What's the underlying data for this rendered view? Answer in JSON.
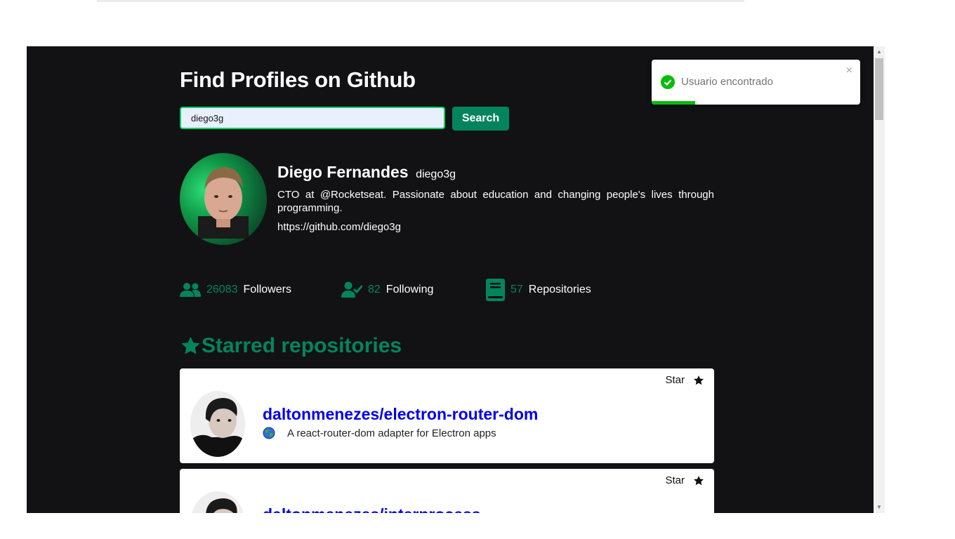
{
  "header": {
    "title": "Find Profiles on Github"
  },
  "search": {
    "value": "diego3g",
    "button_label": "Search"
  },
  "profile": {
    "name": "Diego Fernandes",
    "login": "diego3g",
    "bio": "CTO at @Rocketseat. Passionate about education and changing people's lives through programming.",
    "url": "https://github.com/diego3g"
  },
  "stats": [
    {
      "icon": "users-icon",
      "count": "26083",
      "label": "Followers"
    },
    {
      "icon": "user-check-icon",
      "count": "82",
      "label": "Following"
    },
    {
      "icon": "book-icon",
      "count": "57",
      "label": "Repositories"
    }
  ],
  "starred": {
    "title": "Starred repositories",
    "items": [
      {
        "name": "daltonmenezes/electron-router-dom",
        "description": "A react-router-dom adapter for Electron apps",
        "language_icon": "globe-icon",
        "star_label": "Star"
      },
      {
        "name": "daltonmenezes/interprocess",
        "description": "",
        "star_label": "Star"
      }
    ]
  },
  "toast": {
    "message": "Usuario encontrado",
    "close_label": "×",
    "progress": 0.21
  },
  "colors": {
    "background": "#121214",
    "accent": "#04845d",
    "input_border": "#04d361",
    "link": "#0000ee",
    "toast_success": "#07bc0c"
  }
}
